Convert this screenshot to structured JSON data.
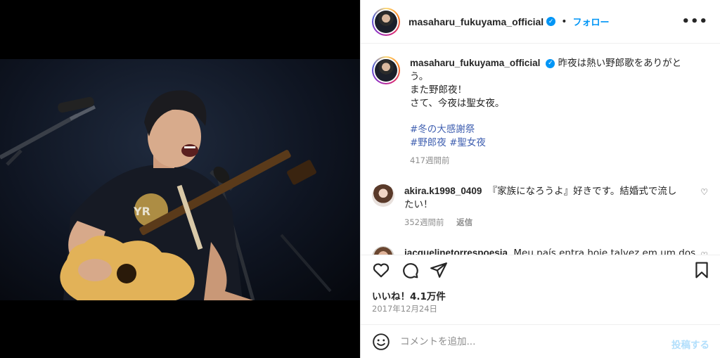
{
  "post": {
    "username": "masaharu_fukuyama_official",
    "follow_label": "フォロー",
    "separator": "•",
    "more_label": "•••",
    "verified_mark": "✓"
  },
  "caption": {
    "username": "masaharu_fukuyama_official",
    "lines": [
      "昨夜は熱い野郎歌をありがとう。",
      "また野郎夜！",
      "さて、今夜は聖女夜。"
    ],
    "hashtags_line1": "#冬の大感謝祭",
    "hashtags_line2": "#野郎夜 #聖女夜",
    "time": "417週間前"
  },
  "comments": [
    {
      "username": "akira.k1998_0409",
      "text_line1": "『家族になろうよ』好きです。結婚式で流し",
      "text_line2": "たい！",
      "time": "352週間前",
      "reply_label": "返信",
      "heart_icon": "heart-outline-icon"
    },
    {
      "username": "jacquelinetorrespoesia",
      "text_line1": "Meu país entra hoje talvez em um dos",
      "heart_icon": "heart-outline-icon"
    }
  ],
  "actions": {
    "like_icon": "heart-icon",
    "comment_icon": "comment-icon",
    "share_icon": "share-icon",
    "save_icon": "bookmark-icon"
  },
  "likes_text": "いいね！4.1万件",
  "date_text": "2017年12月24日",
  "add_comment": {
    "placeholder": "コメントを追加...",
    "post_label": "投稿する",
    "emoji_icon": "smiley-icon"
  },
  "colors": {
    "accent": "#0095f6",
    "hashtag": "#3f5fb0",
    "muted": "#8e8e8e",
    "post_disabled": "#b2dffc"
  }
}
